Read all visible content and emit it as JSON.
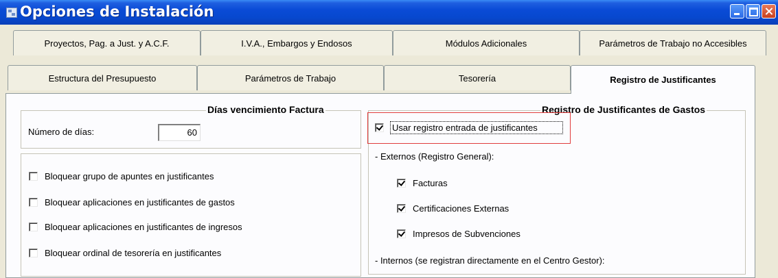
{
  "window": {
    "title": "Opciones de Instalación"
  },
  "tabs": {
    "row1": [
      "Proyectos, Pag. a Just. y A.C.F.",
      "I.V.A., Embargos y Endosos",
      "Módulos Adicionales",
      "Parámetros de Trabajo no Accesibles"
    ],
    "row2": [
      "Estructura del Presupuesto",
      "Parámetros de Trabajo",
      "Tesorería",
      "Registro de Justificantes"
    ],
    "active": "Registro de Justificantes"
  },
  "dias_vencimiento": {
    "title": "Días vencimiento Factura",
    "label": "Número de días:",
    "value": "60"
  },
  "bloqueos": [
    {
      "label": "Bloquear grupo de apuntes en justificantes",
      "checked": false
    },
    {
      "label": "Bloquear aplicaciones en justificantes de gastos",
      "checked": false
    },
    {
      "label": "Bloquear aplicaciones en justificantes de ingresos",
      "checked": false
    },
    {
      "label": "Bloquear ordinal de tesorería en justificantes",
      "checked": false
    }
  ],
  "registro": {
    "title": "Registro de Justificantes de Gastos",
    "usar": {
      "label": "Usar registro entrada de justificantes",
      "checked": true
    },
    "externos_label": "- Externos (Registro General):",
    "externos": [
      {
        "label": "Facturas",
        "checked": true
      },
      {
        "label": "Certificaciones Externas",
        "checked": true
      },
      {
        "label": "Impresos de Subvenciones",
        "checked": true
      }
    ],
    "internos_label": "- Internos (se registran directamente en el Centro Gestor):"
  },
  "colors": {
    "titlebar": "#0a4bd6",
    "highlight": "#e03c3c",
    "dialog_bg": "#ece9d8"
  }
}
